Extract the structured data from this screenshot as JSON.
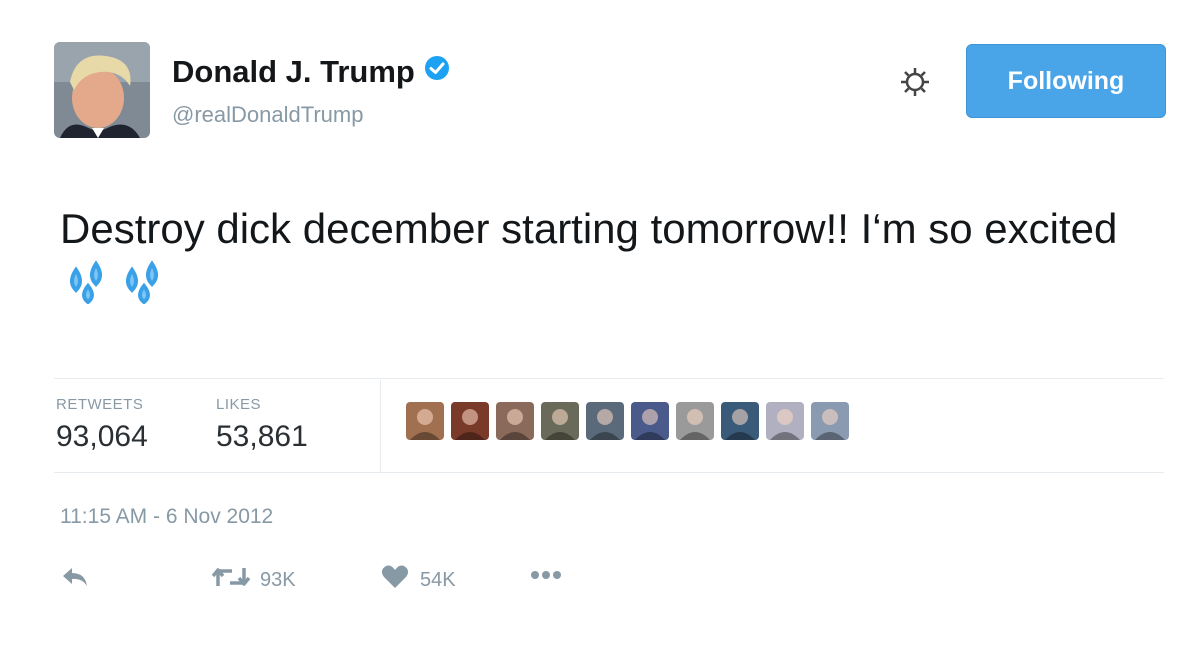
{
  "user": {
    "name": "Donald J. Trump",
    "handle": "@realDonaldTrump",
    "verified": true
  },
  "header": {
    "follow_button_label": "Following",
    "accent_color": "#4aa4e8"
  },
  "tweet": {
    "text": "Destroy dick december starting tomorrow!! I‘m so excited",
    "emojis": [
      "sweat-droplets-icon",
      "sweat-droplets-icon"
    ]
  },
  "stats": {
    "retweets_label": "RETWEETS",
    "retweets_value": "93,064",
    "likes_label": "LIKES",
    "likes_value": "53,861"
  },
  "likers": [
    {
      "tone": "#a07050"
    },
    {
      "tone": "#7a3a2a"
    },
    {
      "tone": "#8a6a5a"
    },
    {
      "tone": "#6a6a5a"
    },
    {
      "tone": "#5a6a7a"
    },
    {
      "tone": "#4a5a8a"
    },
    {
      "tone": "#9a9a9a"
    },
    {
      "tone": "#3a5a7a"
    },
    {
      "tone": "#b0b0c0"
    },
    {
      "tone": "#8a9ab0"
    }
  ],
  "timestamp": "11:15 AM - 6 Nov 2012",
  "actions": {
    "reply_icon": "reply-icon",
    "retweet_icon": "retweet-icon",
    "retweet_count": "93K",
    "like_icon": "heart-icon",
    "like_count": "54K",
    "more_icon": "more-icon"
  }
}
